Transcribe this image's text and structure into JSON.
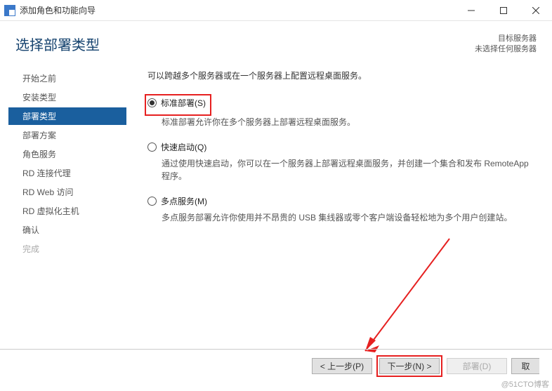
{
  "window": {
    "title": "添加角色和功能向导"
  },
  "header": {
    "page_title": "选择部署类型",
    "target_server_label": "目标服务器",
    "target_server_value": "未选择任何服务器"
  },
  "sidebar": {
    "items": [
      {
        "label": "开始之前",
        "state": "normal"
      },
      {
        "label": "安装类型",
        "state": "normal"
      },
      {
        "label": "部署类型",
        "state": "active"
      },
      {
        "label": "部署方案",
        "state": "normal"
      },
      {
        "label": "角色服务",
        "state": "normal"
      },
      {
        "label": "RD 连接代理",
        "state": "normal"
      },
      {
        "label": "RD Web 访问",
        "state": "normal"
      },
      {
        "label": "RD 虚拟化主机",
        "state": "normal"
      },
      {
        "label": "确认",
        "state": "normal"
      },
      {
        "label": "完成",
        "state": "disabled"
      }
    ]
  },
  "main": {
    "intro": "可以跨越多个服务器或在一个服务器上配置远程桌面服务。",
    "options": [
      {
        "label": "标准部署(S)",
        "desc": "标准部署允许你在多个服务器上部署远程桌面服务。",
        "checked": true,
        "highlighted": true
      },
      {
        "label": "快速启动(Q)",
        "desc": "通过使用快速启动，你可以在一个服务器上部署远程桌面服务，并创建一个集合和发布 RemoteApp 程序。",
        "checked": false,
        "highlighted": false
      },
      {
        "label": "多点服务(M)",
        "desc": "多点服务部署允许你使用并不昂贵的 USB 集线器或零个客户端设备轻松地为多个用户创建站。",
        "checked": false,
        "highlighted": false
      }
    ]
  },
  "footer": {
    "prev": "< 上一步(P)",
    "next": "下一步(N) >",
    "deploy": "部署(D)",
    "cancel": "取"
  },
  "watermark": "@51CTO博客"
}
